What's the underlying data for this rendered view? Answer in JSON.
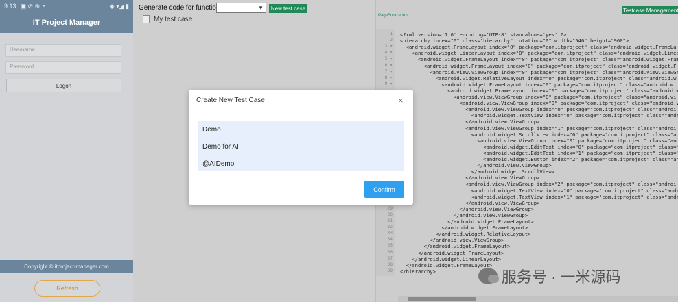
{
  "phone": {
    "status_time": "9:13",
    "status_icons_left": "▣ ⊘ ⊛ ◔",
    "status_icons_right": "◈ ▾◢ ▮",
    "app_title": "IT Project Manager",
    "username_placeholder": "Username",
    "password_placeholder": "Password",
    "logon_label": "Logon",
    "copyright": "Copyright © itproject-manager.com",
    "refresh_label": "Refresh"
  },
  "middle": {
    "generate_label": "Generate code for function:",
    "function_select_value": "",
    "new_test_case_label": "New test case",
    "tree_item": "My test case"
  },
  "right": {
    "testcase_management_label": "Testcase Management",
    "tab_label": "PageSource.xml",
    "line_numbers": [
      "1",
      "2",
      "3 ▾",
      "4 ▾",
      "5 ▾",
      "6 ▾",
      "7 ▾",
      "8 ▾",
      "9 ▾"
    ],
    "line_numbers_lower": [
      "29",
      "30",
      "31",
      "32",
      "33",
      "34",
      "35",
      "36",
      "37",
      "38",
      "39"
    ],
    "code_lines": [
      "<?xml version='1.0' encoding='UTF-8' standalone='yes' ?>",
      "<hierarchy index=\"0\" class=\"hierarchy\" rotation=\"0\" width=\"540\" height=\"960\">",
      "  <android.widget.FrameLayout index=\"0\" package=\"com.itproject\" class=\"android.widget.FrameLa",
      "    <android.widget.LinearLayout index=\"0\" package=\"com.itproject\" class=\"android.widget.Linea",
      "      <android.widget.FrameLayout index=\"0\" package=\"com.itproject\" class=\"android.widget.Fram",
      "        <android.widget.FrameLayout index=\"0\" package=\"com.itproject\" class=\"android.widget.F",
      "          <android.view.ViewGroup index=\"0\" package=\"com.itproject\" class=\"android.view.ViewGr",
      "            <android.widget.RelativeLayout index=\"0\" package=\"com.itproject\" class=\"android.w",
      "              <android.widget.FrameLayout index=\"0\" package=\"com.itproject\" class=\"android.wi",
      "                <android.widget.FrameLayout index=\"0\" package=\"com.itproject\" class=\"android.wi",
      "                  <android.view.ViewGroup index=\"0\" package=\"com.itproject\" class=\"android.vi",
      "                    <android.view.ViewGroup index=\"0\" package=\"com.itproject\" class=\"android.vi",
      "                      <android.view.ViewGroup index=\"0\" package=\"com.itproject\" class=\"androi",
      "                        <android.widget.TextView index=\"0\" package=\"com.itproject\" class=\"andr",
      "                      </android.view.ViewGroup>",
      "                      <android.view.ViewGroup index=\"1\" package=\"com.itproject\" class=\"androi",
      "                        <android.widget.ScrollView index=\"0\" package=\"com.itproject\" class=\"an",
      "                          <android.view.ViewGroup index=\"0\" package=\"com.itproject\" class=\"and",
      "                            <android.widget.EditText index=\"0\" package=\"com.itproject\" class=\"",
      "                            <android.widget.EditText index=\"1\" package=\"com.itproject\" class=\"",
      "                            <android.widget.Button index=\"2\" package=\"com.itproject\" class=\"an",
      "                          </android.view.ViewGroup>",
      "                        </android.widget.ScrollView>",
      "                      </android.view.ViewGroup>",
      "                      <android.view.ViewGroup index=\"2\" package=\"com.itproject\" class=\"androi",
      "                        <android.widget.TextView index=\"0\" package=\"com.itproject\" class=\"andr",
      "                        <android.widget.TextView index=\"1\" package=\"com.itproject\" class=\"andr",
      "                      </android.view.ViewGroup>",
      "                    </android.view.ViewGroup>",
      "                  </android.view.ViewGroup>",
      "                </android.widget.FrameLayout>",
      "              </android.widget.FrameLayout>",
      "            </android.widget.RelativeLayout>",
      "          </android.view.ViewGroup>",
      "        </android.widget.FrameLayout>",
      "      </android.widget.FrameLayout>",
      "    </android.widget.LinearLayout>",
      "  </android.widget.FrameLayout>",
      "</hierarchy>"
    ]
  },
  "modal": {
    "title": "Create New Test Case",
    "close": "×",
    "options": [
      "Demo",
      "Demo for AI",
      "@AIDemo"
    ],
    "confirm_label": "Confirm"
  },
  "watermark": {
    "text": "服务号 · 一米源码"
  },
  "colors": {
    "phone_header": "#6b859c",
    "green_button": "#1f8a57",
    "confirm_blue": "#2fa0f0",
    "refresh_orange": "#d48b1e",
    "option_bg": "#e6effb"
  }
}
